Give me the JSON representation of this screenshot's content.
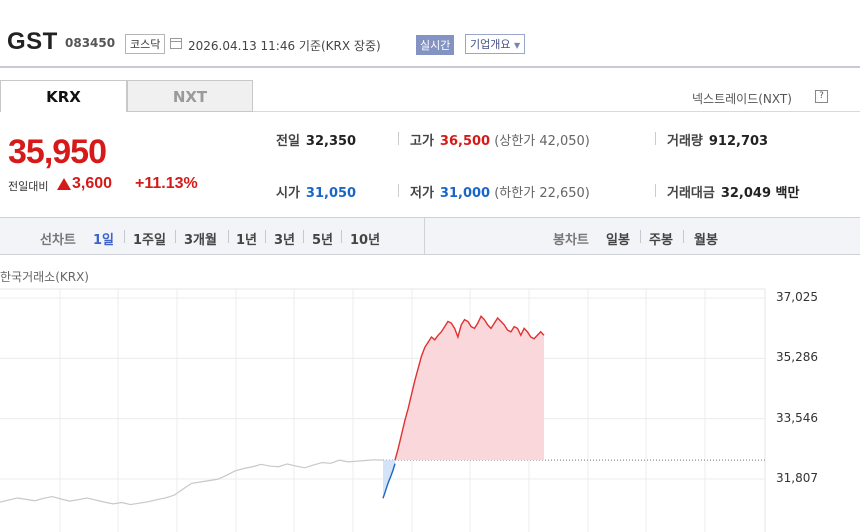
{
  "stock": {
    "name": "GST",
    "code": "083450",
    "market": "코스닥",
    "datetime": "2026.04.13 11:46 기준(KRX 장중)",
    "realtime_label": "실시간",
    "overview_label": "기업개요",
    "overview_caret": "▼"
  },
  "tabs": [
    "KRX",
    "NXT"
  ],
  "nxt_link": "넥스트레이드(NXT)",
  "help_glyph": "?",
  "price": {
    "current": "35,950",
    "change_label": "전일대비",
    "change": "3,600",
    "change_pct": "+11.13%"
  },
  "stats": {
    "prev_close": {
      "label": "전일",
      "value": "32,350"
    },
    "high": {
      "label": "고가",
      "value": "36,500",
      "sub": "(상한가 42,050)"
    },
    "volume": {
      "label": "거래량",
      "value": "912,703"
    },
    "open": {
      "label": "시가",
      "value": "31,050"
    },
    "low": {
      "label": "저가",
      "value": "31,000",
      "sub": "(하한가 22,650)"
    },
    "amount": {
      "label": "거래대금",
      "value": "32,049 백만"
    }
  },
  "periods": {
    "label": "선차트",
    "items": [
      "1일",
      "1주일",
      "3개월",
      "1년",
      "3년",
      "5년",
      "10년"
    ],
    "active": "1일",
    "candle_label": "봉차트",
    "candle_items": [
      "일봉",
      "주봉",
      "월봉"
    ]
  },
  "colors": {
    "up": "#d61a1a",
    "down": "#1a66c6",
    "accent": "#3c63c9"
  },
  "chart_data": {
    "type": "line",
    "title": "한국거래소(KRX)",
    "ylim": [
      30900,
      37200
    ],
    "yticks": [
      37025,
      35286,
      33546,
      31807
    ],
    "ytick_labels": [
      "37,025",
      "35,286",
      "33,546",
      "31,807"
    ],
    "reference": 32350,
    "grid": true,
    "segments": [
      {
        "role": "previous-day",
        "color": "#c8c8c8",
        "values": [
          31140,
          31200,
          31260,
          31220,
          31180,
          31250,
          31300,
          31230,
          31170,
          31210,
          31260,
          31200,
          31140,
          31090,
          31130,
          31070,
          31110,
          31150,
          31210,
          31260,
          31340,
          31510,
          31680,
          31720,
          31760,
          31800,
          31910,
          32040,
          32110,
          32160,
          32230,
          32180,
          32160,
          32240,
          32180,
          32130,
          32210,
          32280,
          32260,
          32350,
          32300,
          32320,
          32340,
          32360,
          32350
        ]
      },
      {
        "role": "today-below-reference",
        "color": "#1a66c6",
        "values": [
          31250,
          31420,
          31600,
          31760,
          31900,
          32060,
          32250
        ]
      },
      {
        "role": "today-above-reference",
        "color": "#e03030",
        "values": [
          32350,
          32700,
          33100,
          33500,
          33850,
          34250,
          34650,
          35000,
          35350,
          35600,
          35750,
          35900,
          35820,
          35950,
          36050,
          36200,
          36350,
          36300,
          36150,
          35900,
          36250,
          36400,
          36350,
          36200,
          36150,
          36300,
          36500,
          36400,
          36250,
          36150,
          36300,
          36450,
          36350,
          36250,
          36100,
          36050,
          36200,
          36150,
          35950,
          36150,
          36050,
          35900,
          35850,
          35950,
          36050,
          35950
        ]
      }
    ]
  }
}
